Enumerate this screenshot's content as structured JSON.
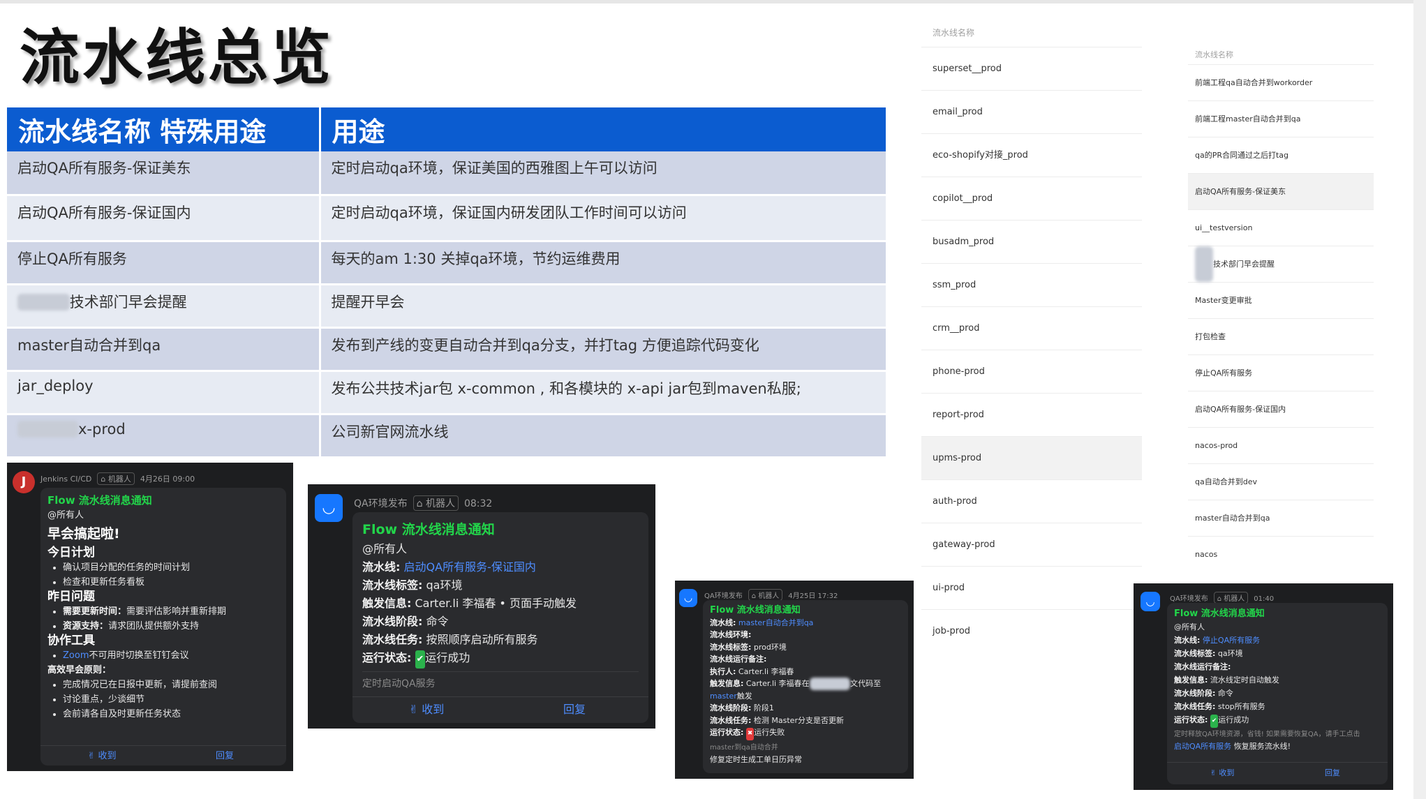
{
  "title": "流水线总览",
  "table": {
    "headers": [
      "流水线名称  特殊用途",
      "用途"
    ],
    "rows": [
      {
        "name": "启动QA所有服务-保证美东",
        "use": "定时启动qa环境，保证美国的西雅图上午可以访问"
      },
      {
        "name": "启动QA所有服务-保证国内",
        "use": "定时启动qa环境，保证国内研发团队工作时间可以访问"
      },
      {
        "name": "停止QA所有服务",
        "use": "每天的am 1:30 关掉qa环境，节约运维费用"
      },
      {
        "name": "技术部门早会提醒",
        "use": "提醒开早会"
      },
      {
        "name": "master自动合并到qa",
        "use": "发布到产线的变更自动合并到qa分支，并打tag 方便追踪代码变化"
      },
      {
        "name": "jar_deploy",
        "use": "发布公共技术jar包 x-common , 和各模块的 x-api jar包到maven私服;"
      },
      {
        "name": "x-prod",
        "use": "公司新官网流水线"
      }
    ]
  },
  "list1": {
    "header": "流水线名称",
    "items": [
      "superset__prod",
      "email_prod",
      "eco-shopify对接_prod",
      "copilot__prod",
      "busadm_prod",
      "ssm_prod",
      "crm__prod",
      "phone-prod",
      "report-prod",
      "upms-prod",
      "auth-prod",
      "gateway-prod",
      "ui-prod",
      "job-prod"
    ]
  },
  "list2": {
    "header": "流水线名称",
    "items": [
      "前端工程qa自动合并到workorder",
      "前端工程master自动合并到qa",
      "qa的PR合同通过之后打tag",
      "启动QA所有服务-保证美东",
      "ui__testversion",
      "技术部门早会提醒",
      "Master变更审批",
      "打包检查",
      "停止QA所有服务",
      "启动QA所有服务-保证国内",
      "nacos-prod",
      "qa自动合并到dev",
      "master自动合并到qa",
      "nacos"
    ]
  },
  "card1": {
    "sender": "Jenkins CI/CD",
    "robot": "机器人",
    "time": "4月26日 09:00",
    "title": "Flow 流水线消息通知",
    "mention": "@所有人",
    "headline": "早会搞起啦!",
    "sec1": "今日计划",
    "sec1_items": [
      "确认项目分配的任务的时间计划",
      "检查和更新任务看板"
    ],
    "sec2": "昨日问题",
    "sec2_items": [
      {
        "k": "需要更新时间：",
        "v": "需要评估影响并重新排期"
      },
      {
        "k": "资源支持：",
        "v": "请求团队提供额外支持"
      }
    ],
    "sec3": "协作工具",
    "sec3_item_link": "Zoom",
    "sec3_item_rest": "不可用时切换至钉钉会议",
    "sec4": "高效早会原则：",
    "sec4_items": [
      "完成情况已在日报中更新，请提前查阅",
      "讨论重点，少谈细节",
      "会前请各自及时更新任务状态"
    ],
    "collect": "收到",
    "reply": "回复"
  },
  "card2": {
    "sender": "QA环境发布",
    "robot": "机器人",
    "time": "08:32",
    "title": "Flow 流水线消息通知",
    "mention": "@所有人",
    "l1k": "流水线:",
    "l1v": "启动QA所有服务-保证国内",
    "l2k": "流水线标签:",
    "l2v": "qa环境",
    "l3k": "触发信息:",
    "l3v": "Carter.li 李福春 • 页面手动触发",
    "l4k": "流水线阶段:",
    "l4v": "命令",
    "l5k": "流水线任务:",
    "l5v": "按照顺序启动所有服务",
    "l6k": "运行状态:",
    "l6v": "运行成功",
    "note": "定时启动QA服务",
    "collect": "收到",
    "reply": "回复"
  },
  "card3": {
    "sender": "QA环境发布",
    "robot": "机器人",
    "time": "4月25日 17:32",
    "title": "Flow 流水线消息通知",
    "l1k": "流水线:",
    "l1v": "master自动合并到qa",
    "l2k": "流水线环境:",
    "l3k": "流水线标签:",
    "l3v": "prod环境",
    "l4k": "流水线运行备注:",
    "l5k": "执行人:",
    "l5v": "Carter.li 李福春",
    "l6k": "触发信息:",
    "l6v": "Carter.li 李福春在",
    "l6v2": "文代码至",
    "l6v3": "master",
    "l6v4": "触发",
    "l7k": "流水线阶段:",
    "l7v": "阶段1",
    "l8k": "流水线任务:",
    "l8v": "检测 Master分支是否更新",
    "l9k": "运行状态:",
    "l9v": "运行失败",
    "note": "master到qa自动合并",
    "note2": "修复定时生成工单日历异常"
  },
  "card4": {
    "sender": "QA环境发布",
    "robot": "机器人",
    "time": "01:40",
    "title": "Flow 流水线消息通知",
    "mention": "@所有人",
    "l1k": "流水线:",
    "l1v": "停止QA所有服务",
    "l2k": "流水线标签:",
    "l2v": "qa环境",
    "l3k": "流水线运行备注:",
    "l4k": "触发信息:",
    "l4v": "流水线定时自动触发",
    "l5k": "流水线阶段:",
    "l5v": "命令",
    "l6k": "流水线任务:",
    "l6v": "stop所有服务",
    "l7k": "运行状态:",
    "l7v": "运行成功",
    "note": "定时释放QA环境资源，省钱! 如果需要恢复QA，请手工点击",
    "note_link": "启动QA所有服务",
    "note_rest": "恢复服务流水线!",
    "collect": "收到",
    "reply": "回复"
  }
}
